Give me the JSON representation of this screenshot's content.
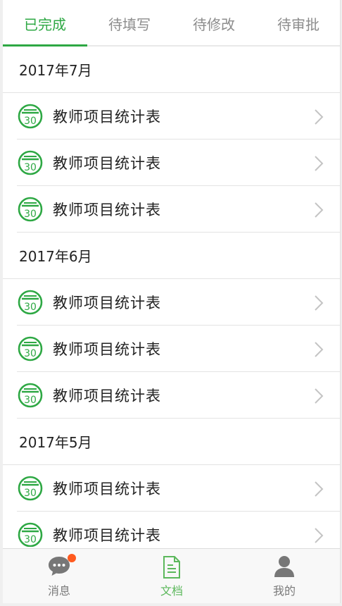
{
  "tabs": [
    {
      "label": "已完成",
      "active": true
    },
    {
      "label": "待填写",
      "active": false
    },
    {
      "label": "待修改",
      "active": false
    },
    {
      "label": "待审批",
      "active": false
    }
  ],
  "groups": [
    {
      "month": "2017年7月",
      "items": [
        {
          "title": "教师项目统计表",
          "icon_num": "30"
        },
        {
          "title": "教师项目统计表",
          "icon_num": "30"
        },
        {
          "title": "教师项目统计表",
          "icon_num": "30"
        }
      ]
    },
    {
      "month": "2017年6月",
      "items": [
        {
          "title": "教师项目统计表",
          "icon_num": "30"
        },
        {
          "title": "教师项目统计表",
          "icon_num": "30"
        },
        {
          "title": "教师项目统计表",
          "icon_num": "30"
        }
      ]
    },
    {
      "month": "2017年5月",
      "items": [
        {
          "title": "教师项目统计表",
          "icon_num": "30"
        },
        {
          "title": "教师项目统计表",
          "icon_num": "30"
        }
      ]
    }
  ],
  "nav": [
    {
      "label": "消息",
      "icon": "chat-bubble-icon",
      "badge": true,
      "active": false
    },
    {
      "label": "文档",
      "icon": "document-icon",
      "badge": false,
      "active": true
    },
    {
      "label": "我的",
      "icon": "person-icon",
      "badge": false,
      "active": false
    }
  ],
  "colors": {
    "accent": "#2ea844",
    "badge": "#ff5a1f",
    "nav_active": "#5cb85c"
  }
}
